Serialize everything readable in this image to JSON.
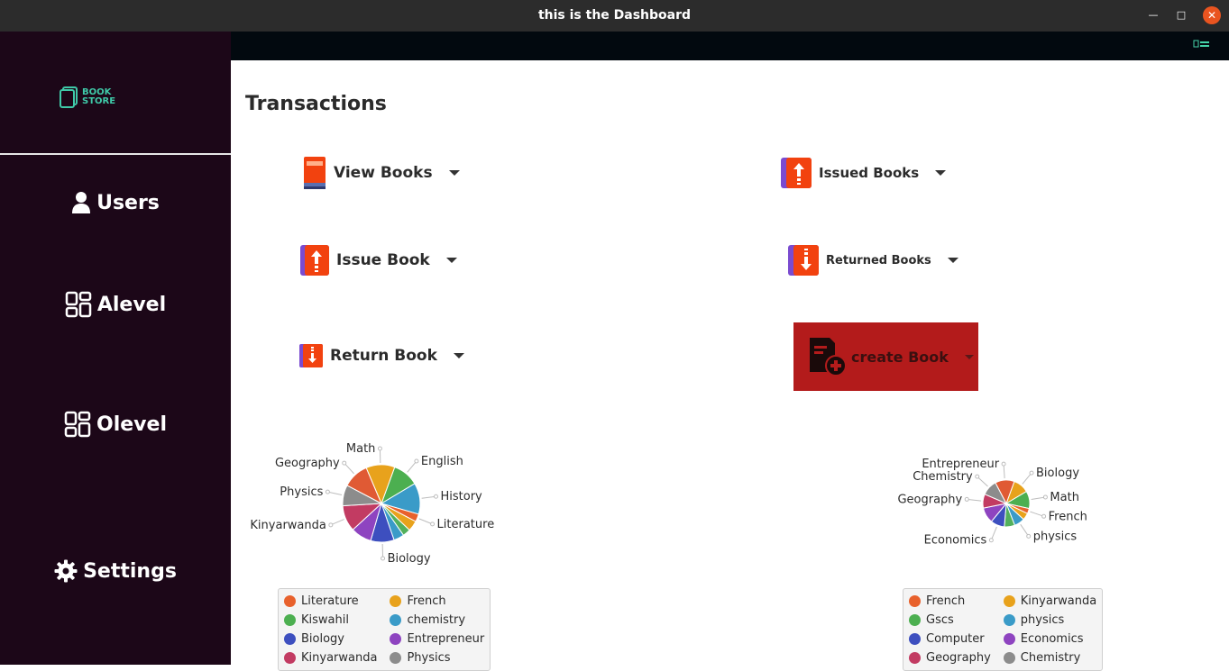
{
  "window": {
    "title": "this is the Dashboard"
  },
  "sidebar": {
    "logo": {
      "line1": "BOOK",
      "line2": "STORE"
    },
    "items": [
      {
        "label": "Users",
        "icon": "user-icon"
      },
      {
        "label": "Alevel",
        "icon": "grid-icon"
      },
      {
        "label": "Olevel",
        "icon": "grid-icon"
      },
      {
        "label": "Settings",
        "icon": "gear-icon"
      }
    ]
  },
  "main": {
    "heading": "Transactions",
    "buttons": {
      "view_books": "View Books",
      "issued_books": "Issued Books",
      "issue_book": "Issue Book",
      "returned_books": "Returned Books",
      "return_book": "Return Book",
      "create_book": "create Book"
    }
  },
  "colors": {
    "sidebar_bg": "#1c0718",
    "accent_red": "#b31b1b",
    "icon_orange": "#f2420f",
    "icon_purple": "#7a4bd0",
    "logo_teal": "#3fc9a8"
  },
  "chart_data": [
    {
      "type": "pie",
      "slices": [
        {
          "label": "English",
          "value": 10,
          "color": "#4caf50"
        },
        {
          "label": "History",
          "value": 12,
          "color": "#3a9bc8"
        },
        {
          "label": "Literature",
          "value": 3,
          "color": "#e8612c"
        },
        {
          "label": "",
          "value": 4,
          "color": "#e8a21c"
        },
        {
          "label": "",
          "value": 3,
          "color": "#52b05c"
        },
        {
          "label": "",
          "value": 4,
          "color": "#3a9bc8"
        },
        {
          "label": "Biology",
          "value": 9,
          "color": "#3d4fbf"
        },
        {
          "label": "",
          "value": 8,
          "color": "#8e44c0"
        },
        {
          "label": "Kinyarwanda",
          "value": 10,
          "color": "#c23b62"
        },
        {
          "label": "Physics",
          "value": 8,
          "color": "#8c8c8c"
        },
        {
          "label": "Geography",
          "value": 10,
          "color": "#e05a34"
        },
        {
          "label": "Math",
          "value": 11,
          "color": "#e8a21c"
        }
      ],
      "legend": [
        {
          "label": "Literature",
          "color": "#e8612c"
        },
        {
          "label": "French",
          "color": "#e8a21c"
        },
        {
          "label": "Kiswahil",
          "color": "#4caf50"
        },
        {
          "label": "chemistry",
          "color": "#3a9bc8"
        },
        {
          "label": "Biology",
          "color": "#3d4fbf"
        },
        {
          "label": "Entrepreneur",
          "color": "#8e44c0"
        },
        {
          "label": "Kinyarwanda",
          "color": "#c23b62"
        },
        {
          "label": "Physics",
          "color": "#8c8c8c"
        }
      ]
    },
    {
      "type": "pie",
      "slices": [
        {
          "label": "Biology",
          "value": 9,
          "color": "#e8a21c"
        },
        {
          "label": "Math",
          "value": 10,
          "color": "#4caf50"
        },
        {
          "label": "French",
          "value": 3,
          "color": "#e8612c"
        },
        {
          "label": "",
          "value": 4,
          "color": "#e8a21c"
        },
        {
          "label": "physics",
          "value": 6,
          "color": "#3a9bc8"
        },
        {
          "label": "",
          "value": 6,
          "color": "#52b05c"
        },
        {
          "label": "Economics",
          "value": 8,
          "color": "#3d4fbf"
        },
        {
          "label": "",
          "value": 9,
          "color": "#8e44c0"
        },
        {
          "label": "Geography",
          "value": 8,
          "color": "#c23b62"
        },
        {
          "label": "Chemistry",
          "value": 9,
          "color": "#8c8c8c"
        },
        {
          "label": "Entrepreneur",
          "value": 11,
          "color": "#e05a34"
        }
      ],
      "legend": [
        {
          "label": "French",
          "color": "#e8612c"
        },
        {
          "label": "Kinyarwanda",
          "color": "#e8a21c"
        },
        {
          "label": "Gscs",
          "color": "#4caf50"
        },
        {
          "label": "physics",
          "color": "#3a9bc8"
        },
        {
          "label": "Computer",
          "color": "#3d4fbf"
        },
        {
          "label": "Economics",
          "color": "#8e44c0"
        },
        {
          "label": "Geography",
          "color": "#c23b62"
        },
        {
          "label": "Chemistry",
          "color": "#8c8c8c"
        }
      ]
    }
  ]
}
